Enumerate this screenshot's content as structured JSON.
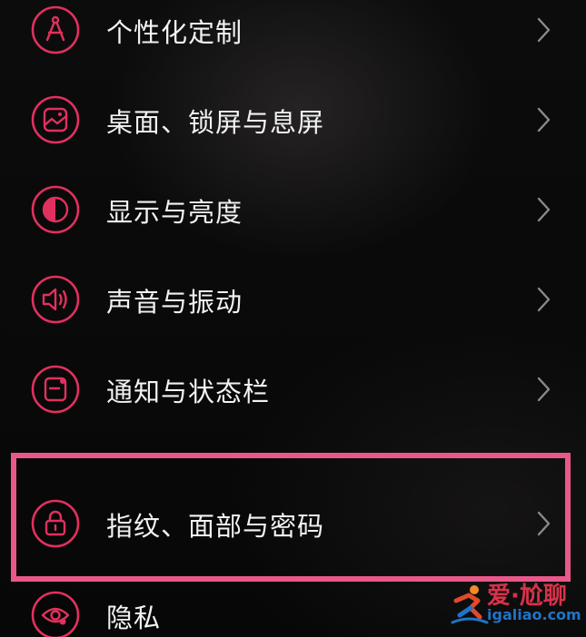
{
  "settings": {
    "items": [
      {
        "label": "个性化定制",
        "icon": "compass-icon"
      },
      {
        "label": "桌面、锁屏与息屏",
        "icon": "wallpaper-icon"
      },
      {
        "label": "显示与亮度",
        "icon": "brightness-icon"
      },
      {
        "label": "声音与振动",
        "icon": "speaker-icon"
      },
      {
        "label": "通知与状态栏",
        "icon": "notification-icon"
      },
      {
        "label": "指纹、面部与密码",
        "icon": "lock-icon"
      },
      {
        "label": "隐私",
        "icon": "privacy-eye-icon"
      }
    ]
  },
  "colors": {
    "accent": "#e2305e",
    "highlight_border": "#e9588a",
    "label_text": "#f2f2f2",
    "chevron": "#8a8a8a"
  },
  "watermark": {
    "line1": "爱·尬聊",
    "line2": "igaliao.com"
  }
}
